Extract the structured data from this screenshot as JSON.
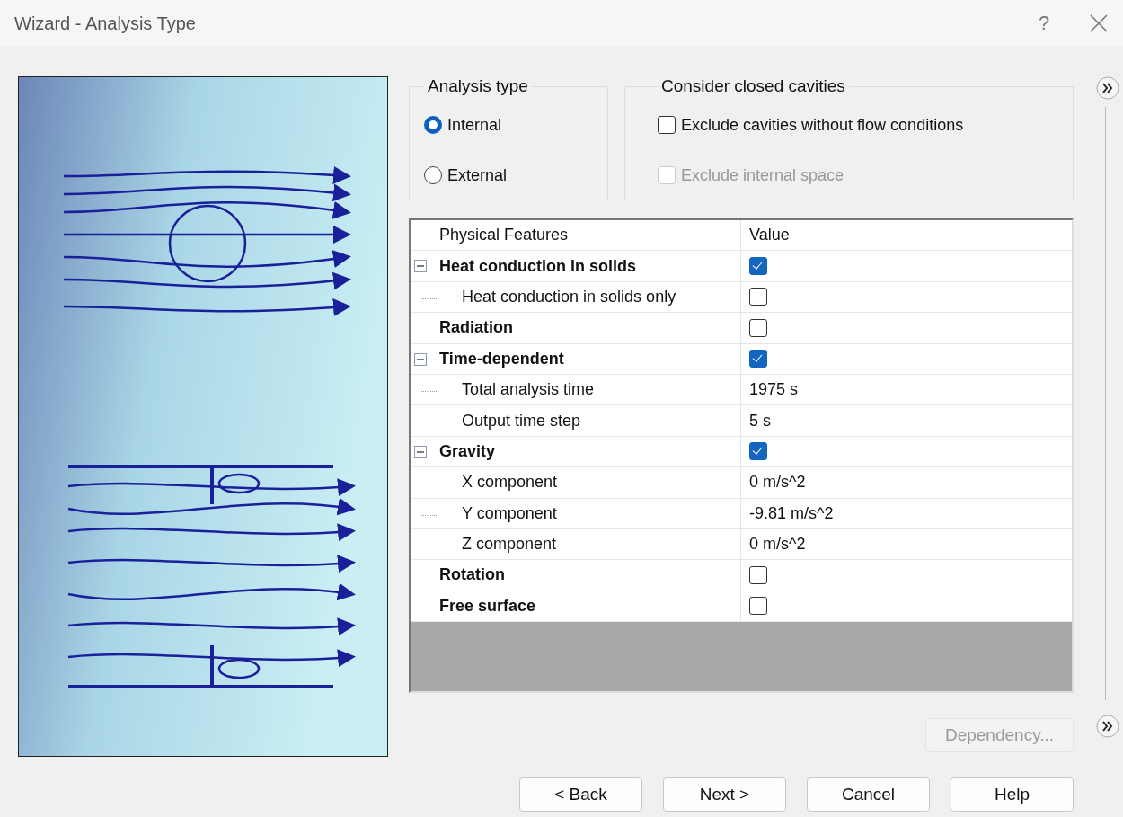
{
  "window": {
    "title": "Wizard - Analysis Type",
    "help": "?"
  },
  "analysis_type": {
    "title": "Analysis type",
    "options": [
      {
        "label": "Internal",
        "selected": true
      },
      {
        "label": "External",
        "selected": false
      }
    ]
  },
  "closed_cavities": {
    "title": "Consider closed cavities",
    "options": [
      {
        "label": "Exclude cavities without flow conditions",
        "checked": false,
        "disabled": false
      },
      {
        "label": "Exclude internal space",
        "checked": false,
        "disabled": true
      }
    ]
  },
  "features": {
    "columns": [
      "Physical Features",
      "Value"
    ],
    "rows": [
      {
        "label": "Heat conduction in solids",
        "kind": "checkbox",
        "checked": true,
        "expanded": true,
        "children": [
          {
            "label": "Heat conduction in solids only",
            "kind": "checkbox",
            "checked": false
          }
        ]
      },
      {
        "label": "Radiation",
        "kind": "checkbox",
        "checked": false
      },
      {
        "label": "Time-dependent",
        "kind": "checkbox",
        "checked": true,
        "expanded": true,
        "children": [
          {
            "label": "Total analysis time",
            "kind": "text",
            "value": "1975 s"
          },
          {
            "label": "Output time step",
            "kind": "text",
            "value": "5 s"
          }
        ]
      },
      {
        "label": "Gravity",
        "kind": "checkbox",
        "checked": true,
        "expanded": true,
        "children": [
          {
            "label": "X component",
            "kind": "text",
            "value": "0 m/s^2"
          },
          {
            "label": "Y component",
            "kind": "text",
            "value": "-9.81 m/s^2"
          },
          {
            "label": "Z component",
            "kind": "text",
            "value": "0 m/s^2"
          }
        ]
      },
      {
        "label": "Rotation",
        "kind": "checkbox",
        "checked": false
      },
      {
        "label": "Free surface",
        "kind": "checkbox",
        "checked": false
      }
    ]
  },
  "dependency_button": {
    "label": "Dependency...",
    "disabled": true
  },
  "buttons": [
    "< Back",
    "Next >",
    "Cancel",
    "Help"
  ]
}
